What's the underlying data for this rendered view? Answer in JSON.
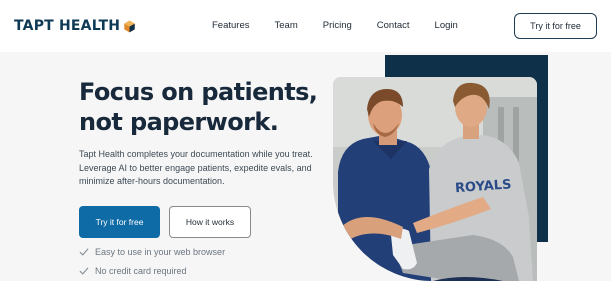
{
  "brand": {
    "name": "TAPT HEALTH"
  },
  "nav": {
    "links": [
      "Features",
      "Team",
      "Pricing",
      "Contact",
      "Login"
    ],
    "cta_label": "Try it for free"
  },
  "hero": {
    "headline_line1": "Focus on patients,",
    "headline_line2": "not paperwork.",
    "description": "Tapt Health completes your documentation while you treat. Leverage AI to better engage patients, expedite evals, and minimize after-hours documentation.",
    "primary_button": "Try it for free",
    "secondary_button": "How it works",
    "checks": [
      "Easy to use in your web browser",
      "No credit card required"
    ]
  },
  "image": {
    "shirt_text": "ROYALS"
  },
  "colors": {
    "primary": "#0f6ba6",
    "navy": "#0f3049",
    "logo_orange": "#e08a2b"
  }
}
